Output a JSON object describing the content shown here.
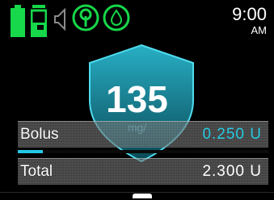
{
  "status_bar": {
    "icons": [
      "battery-icon",
      "insulin-cartridge-icon",
      "speaker-muted-icon",
      "cgm-antenna-icon",
      "drop-icon"
    ],
    "colors": {
      "battery": "#16d84a",
      "cartridge": "#16d84a",
      "speaker": "#8a8a8a",
      "antenna": "#16d84a",
      "drop": "#16d84a"
    },
    "time": "9:00",
    "ampm": "AM"
  },
  "glucose": {
    "value": "135",
    "subtext": "mg/",
    "shield_color": "#23c8e6"
  },
  "bolus": {
    "label": "Bolus",
    "value": "0.250 U",
    "progress_fraction": 0.1
  },
  "total": {
    "label": "Total",
    "value": "2.300 U"
  }
}
